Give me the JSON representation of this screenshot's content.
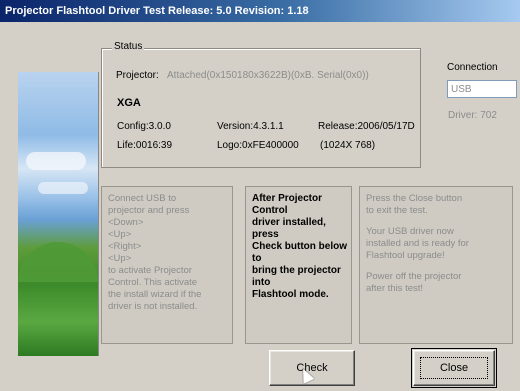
{
  "window": {
    "title": "Projector Flashtool Driver Test   Release: 5.0  Revision: 1.18"
  },
  "status": {
    "legend": "Status",
    "projector_label": "Projector:",
    "projector_value": "Attached(0x150180x3622B)(0xB. Serial(0x0))",
    "model": "XGA",
    "config": "Config:3.0.0",
    "version": "Version:4.3.1.1",
    "release": "Release:2006/05/17D",
    "life": "Life:0016:39",
    "logo": "Logo:0xFE400000",
    "resolution": "(1024X 768)"
  },
  "connection": {
    "label": "Connection",
    "value": "USB",
    "driver": "Driver: 702"
  },
  "panels": {
    "left": [
      "Connect USB to",
      "projector and press",
      "<Down>",
      "<Up>",
      "<Right>",
      "<Up>",
      "to activate Projector",
      "Control. This activate",
      "the install wizard if the",
      "driver is not installed."
    ],
    "middle": [
      "After Projector",
      "Control",
      "driver installed,",
      "press",
      "Check button below",
      "to",
      "bring the projector",
      "into",
      "Flashtool mode."
    ],
    "right_a": [
      "Press the Close button",
      "to exit the test."
    ],
    "right_b": [
      "Your USB driver now",
      "installed and is ready for",
      "Flashtool upgrade!"
    ],
    "right_c": [
      "Power off the projector",
      "after this test!"
    ]
  },
  "buttons": {
    "check": "Check",
    "close": "Close"
  }
}
